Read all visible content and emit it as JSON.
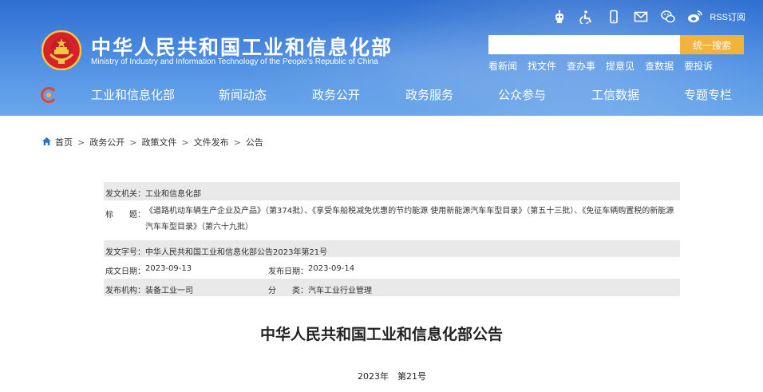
{
  "header": {
    "site_title": "中华人民共和国工业和信息化部",
    "site_subtitle": "Ministry of Industry and Information Technology of the People's Republic of China",
    "rss_label": "RSS订阅",
    "top_icons": [
      "robot-icon",
      "accessibility-icon",
      "mobile-icon",
      "mail-icon",
      "wechat-icon",
      "weibo-icon"
    ],
    "search": {
      "placeholder": "",
      "button_label": "统一搜索"
    },
    "quick_links": [
      "看新闻",
      "找文件",
      "查办事",
      "提意见",
      "查数据",
      "要投诉"
    ],
    "nav_items": [
      "工业和信息化部",
      "新闻动态",
      "政务公开",
      "政务服务",
      "公众参与",
      "工信数据",
      "专题专栏"
    ]
  },
  "breadcrumb": [
    "首页",
    "政务公开",
    "政策文件",
    "文件发布",
    "公告"
  ],
  "meta": {
    "issuer_label": "发文机关：",
    "issuer": "工业和信息化部",
    "title_label": "标　　题：",
    "title": "《道路机动车辆生产企业及产品》（第374批）、《享受车船税减免优惠的节约能源 使用新能源汽车车型目录》（第五十三批）、《免征车辆购置税的新能源汽车车型目录》（第六十九批）",
    "doc_no_label": "发文字号：",
    "doc_no": "中华人民共和国工业和信息化部公告2023年第21号",
    "created_label": "成文日期：",
    "created": "2023-09-13",
    "published_label": "发布日期：",
    "published": "2023-09-14",
    "org_label": "发布机构：",
    "org": "装备工业一司",
    "category_label": "分　　类：",
    "category": "汽车工业行业管理"
  },
  "document": {
    "title": "中华人民共和国工业和信息化部公告",
    "number": "2023年　第21号"
  },
  "colors": {
    "header_blue": "#3d7fdb",
    "search_button": "#f2b33d",
    "meta_row_bg": "#e9e9e9"
  }
}
